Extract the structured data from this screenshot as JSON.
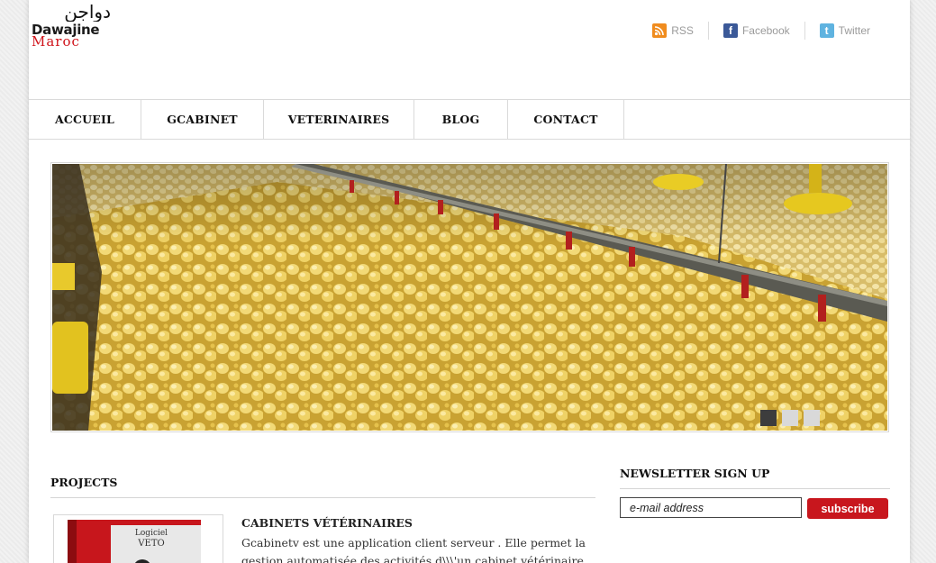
{
  "logo": {
    "arabic": "دواجن",
    "line1": "Dawajine",
    "line2": "Maroc"
  },
  "social": [
    {
      "label": "RSS",
      "icon": "rss-icon",
      "color": "#f08c1e"
    },
    {
      "label": "Facebook",
      "icon": "facebook-icon",
      "color": "#3b5998"
    },
    {
      "label": "Twitter",
      "icon": "twitter-icon",
      "color": "#5fb3e0"
    }
  ],
  "nav": [
    "ACCUEIL",
    "GCABINET",
    "VETERINAIRES",
    "BLOG",
    "CONTACT"
  ],
  "slider": {
    "active_index": 0,
    "total": 3
  },
  "projects": {
    "heading": "PROJECTS",
    "item": {
      "title": "CABINETS VÉTÉRINAIRES",
      "text": "Gcabinetv est une application client serveur . Elle permet la gestion automatisée des activités d\\\\\\'un cabinet vétérinaire. L'interface, simple",
      "thumb_line1": "Logiciel",
      "thumb_line2": "VETO"
    }
  },
  "newsletter": {
    "heading": "NEWSLETTER SIGN UP",
    "placeholder": "e-mail address",
    "button": "subscribe"
  },
  "colors": {
    "accent": "#c8161d",
    "nav_border": "#dadada"
  }
}
